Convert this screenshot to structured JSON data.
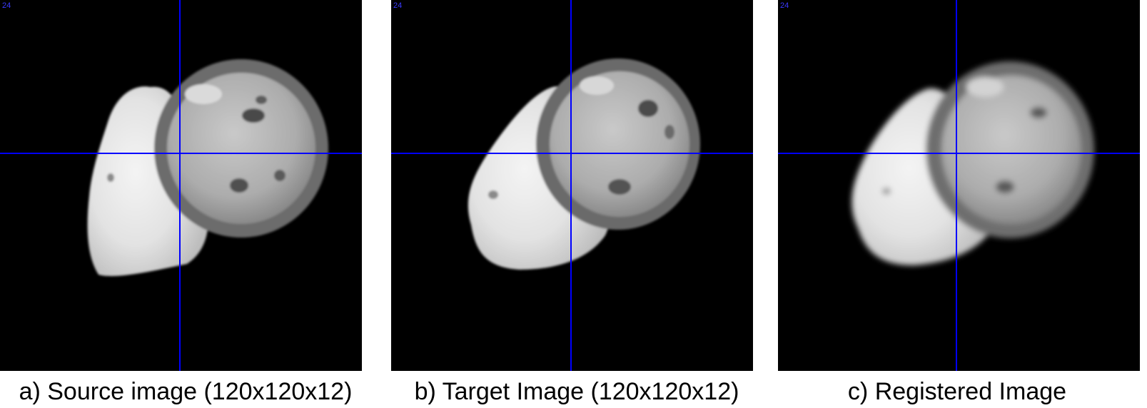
{
  "colors": {
    "crosshair": "#0000ff",
    "slice_number": "#3a3aff",
    "background": "#000000"
  },
  "panels": [
    {
      "slice_number": "24",
      "caption": "a) Source image (120x120x12)"
    },
    {
      "slice_number": "24",
      "caption": "b) Target Image (120x120x12)"
    },
    {
      "slice_number": "24",
      "caption": "c) Registered Image"
    }
  ]
}
